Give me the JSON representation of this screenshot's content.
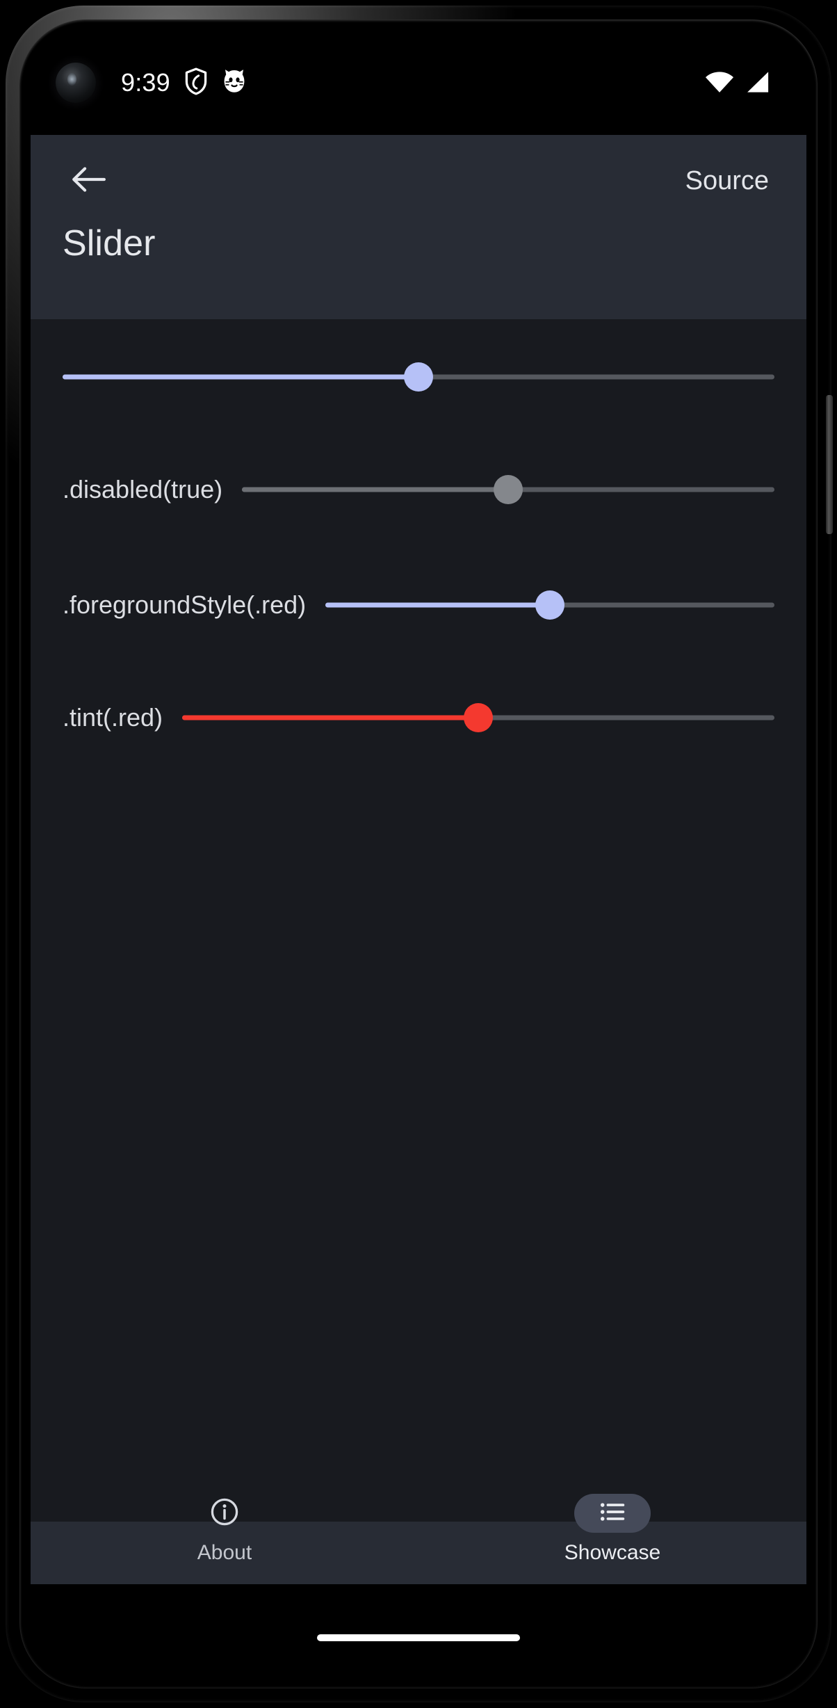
{
  "status_bar": {
    "clock": "9:39",
    "left_icons": [
      {
        "name": "shield-icon",
        "label": "shield"
      },
      {
        "name": "cat-face-icon",
        "label": "cat-face"
      }
    ],
    "right_icons": [
      {
        "name": "wifi-icon",
        "label": "wifi"
      },
      {
        "name": "cellular-signal-icon",
        "label": "cellular-signal"
      }
    ]
  },
  "app_bar": {
    "back_icon": "arrow-left-icon",
    "source_label": "Source",
    "title": "Slider"
  },
  "content": {
    "sliders": [
      {
        "id": "slider-default",
        "label": "",
        "value_percent": 50,
        "fill_color": "#b6c1f7",
        "thumb_color": "#b6c1f7",
        "track_color": "#55585e",
        "disabled": false
      },
      {
        "id": "slider-disabled",
        "label": ".disabled(true)",
        "value_percent": 50,
        "fill_color": "#6d7075",
        "thumb_color": "#84878c",
        "track_color": "#55585e",
        "disabled": true
      },
      {
        "id": "slider-foregroundstyle-red",
        "label": ".foregroundStyle(.red)",
        "value_percent": 50,
        "fill_color": "#b6c1f7",
        "thumb_color": "#b6c1f7",
        "track_color": "#55585e",
        "disabled": false
      },
      {
        "id": "slider-tint-red",
        "label": ".tint(.red)",
        "value_percent": 50,
        "fill_color": "#f4392f",
        "thumb_color": "#f4392f",
        "track_color": "#55585e",
        "disabled": false
      }
    ]
  },
  "bottom_nav": {
    "items": [
      {
        "id": "about",
        "icon": "info-circle-icon",
        "label": "About",
        "active": false
      },
      {
        "id": "showcase",
        "icon": "list-icon",
        "label": "Showcase",
        "active": true
      }
    ]
  },
  "colors": {
    "screen_background": "#181a1f",
    "app_bar_background": "#282c35",
    "accent_blue": "#b6c1f7",
    "accent_red": "#f4392f",
    "nav_pill_active": "#454a59"
  }
}
